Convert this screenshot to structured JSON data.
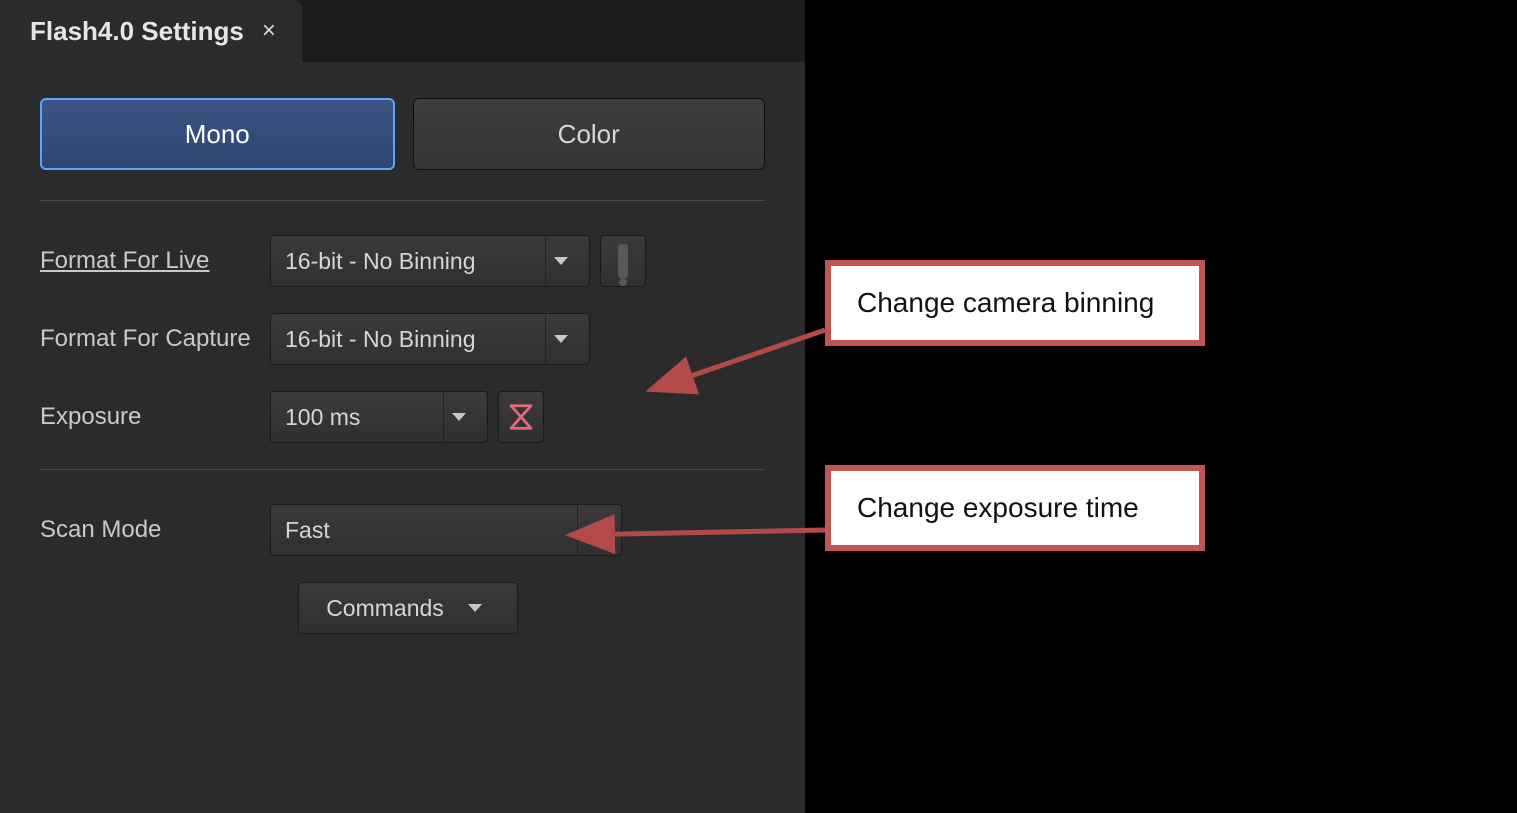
{
  "tab": {
    "title": "Flash4.0 Settings",
    "close": "×"
  },
  "modes": {
    "mono": "Mono",
    "color": "Color"
  },
  "fields": {
    "format_live_label": "Format For Live",
    "format_live_value": "16-bit - No Binning",
    "format_capture_label": "Format For Capture",
    "format_capture_value": "16-bit - No Binning",
    "exposure_label": "Exposure",
    "exposure_value": "100 ms",
    "scan_label": "Scan Mode",
    "scan_value": "Fast",
    "commands_label": "Commands"
  },
  "callouts": {
    "binning": "Change camera binning",
    "exposure": "Change exposure time"
  }
}
